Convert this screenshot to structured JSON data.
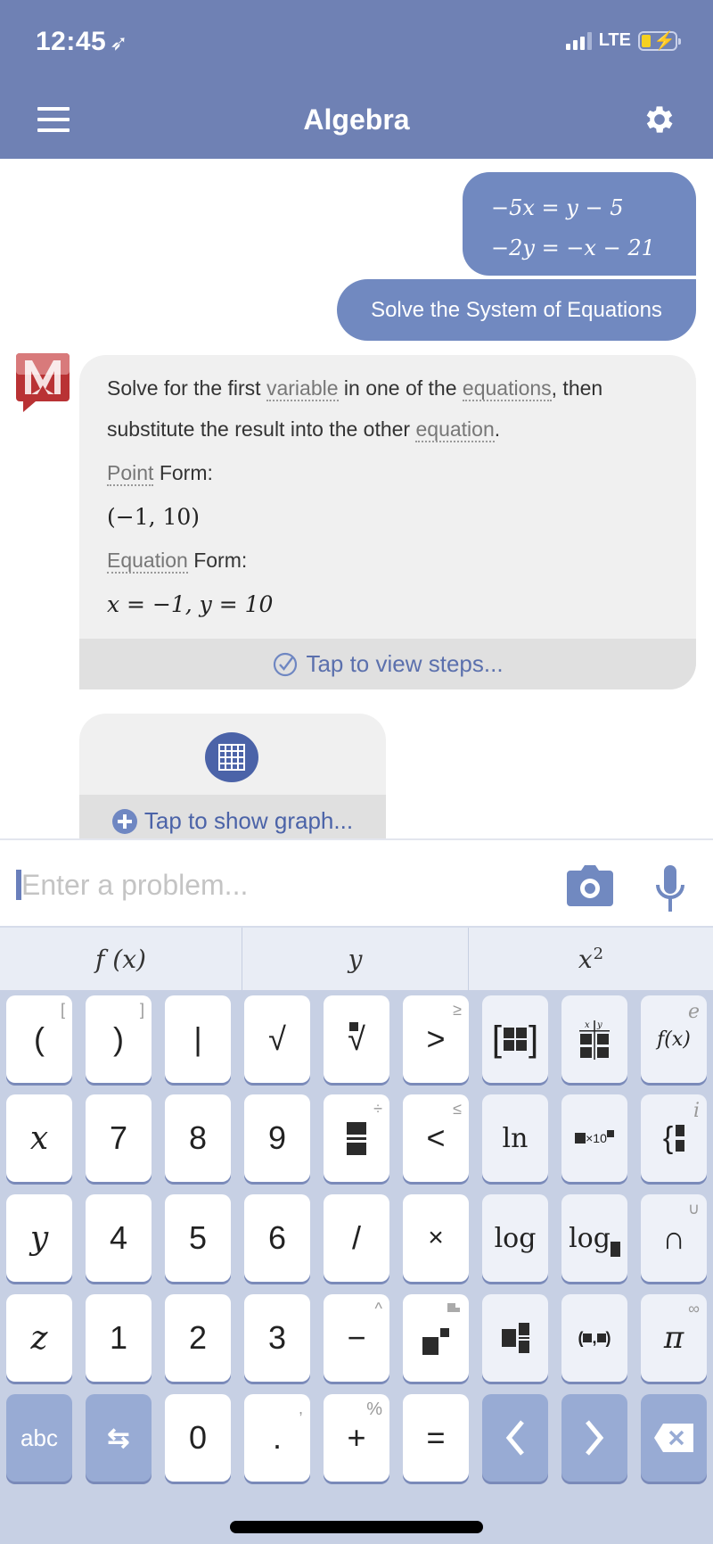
{
  "status_bar": {
    "time": "12:45",
    "network": "LTE",
    "signal_bars": 3,
    "signal_max": 4,
    "charging": true
  },
  "header": {
    "title": "Algebra",
    "menu_icon": "hamburger-menu-icon",
    "settings_icon": "gear-icon"
  },
  "colors": {
    "header_bg": "#6f81b4",
    "user_bubble": "#7189c0",
    "link_blue": "#5b70ad",
    "logo_red": "#b93234"
  },
  "chat": {
    "user_equations": [
      "−5x = y − 5",
      "−2y = −x − 21"
    ],
    "user_command": "Solve the System of Equations",
    "answer": {
      "intro_parts": [
        {
          "text": "Solve for the first ",
          "link": false
        },
        {
          "text": "variable",
          "link": true
        },
        {
          "text": " in one of the ",
          "link": false
        },
        {
          "text": "equations",
          "link": true
        },
        {
          "text": ", then substitute the result into the other ",
          "link": false
        },
        {
          "text": "equation",
          "link": true
        },
        {
          "text": ".",
          "link": false
        }
      ],
      "point_form_link": "Point",
      "point_form_label": " Form:",
      "point_form_value": "(−1, 10)",
      "equation_form_link": "Equation",
      "equation_form_label": " Form:",
      "equation_form_value": "x = −1, y = 10",
      "steps_label": "Tap to view steps..."
    },
    "graph_label": "Tap to show graph..."
  },
  "input": {
    "placeholder": "Enter a problem...",
    "value": ""
  },
  "keyboard": {
    "tabs": [
      {
        "label": "f (x)"
      },
      {
        "label": "y"
      },
      {
        "label": "x",
        "sup": "2"
      }
    ],
    "rows": [
      [
        {
          "main": "(",
          "alt": "["
        },
        {
          "main": ")",
          "alt": "]"
        },
        {
          "main": "|"
        },
        {
          "main": "√"
        },
        {
          "main": "ⁿ√",
          "name": "nth-root"
        },
        {
          "main": ">",
          "alt": "≥"
        },
        {
          "main": "matrix",
          "name": "matrix",
          "style": "light"
        },
        {
          "main": "table",
          "name": "xy-table",
          "style": "light"
        },
        {
          "main": "f(x)",
          "alt": "e",
          "style": "light"
        }
      ],
      [
        {
          "main": "x"
        },
        {
          "main": "7"
        },
        {
          "main": "8"
        },
        {
          "main": "9"
        },
        {
          "main": "fraction",
          "name": "fraction",
          "alt": "÷"
        },
        {
          "main": "<",
          "alt": "≤"
        },
        {
          "main": "ln",
          "style": "light"
        },
        {
          "main": "×10",
          "name": "scientific-notation",
          "style": "light"
        },
        {
          "main": "{",
          "name": "piecewise",
          "alt": "i",
          "style": "light"
        }
      ],
      [
        {
          "main": "y"
        },
        {
          "main": "4"
        },
        {
          "main": "5"
        },
        {
          "main": "6"
        },
        {
          "main": "/"
        },
        {
          "main": "×"
        },
        {
          "main": "log",
          "style": "light"
        },
        {
          "main": "log",
          "name": "log-base",
          "style": "light"
        },
        {
          "main": "∩",
          "alt": "∪",
          "style": "light"
        }
      ],
      [
        {
          "main": "z"
        },
        {
          "main": "1"
        },
        {
          "main": "2"
        },
        {
          "main": "3"
        },
        {
          "main": "−",
          "alt": "^"
        },
        {
          "main": "exponent",
          "name": "exponent",
          "alt": "subscript"
        },
        {
          "main": "mixed-fraction",
          "name": "mixed-fraction",
          "style": "light"
        },
        {
          "main": "(■,■)",
          "name": "ordered-pair",
          "style": "light"
        },
        {
          "main": "π",
          "alt": "∞",
          "style": "light"
        }
      ],
      [
        {
          "main": "abc",
          "style": "dark"
        },
        {
          "main": "⇆",
          "name": "swap",
          "style": "dark"
        },
        {
          "main": "0"
        },
        {
          "main": ".",
          "alt": ","
        },
        {
          "main": "+",
          "alt": "%"
        },
        {
          "main": "="
        },
        {
          "main": "‹",
          "name": "cursor-left",
          "style": "dark"
        },
        {
          "main": "›",
          "name": "cursor-right",
          "style": "dark"
        },
        {
          "main": "⌫",
          "name": "backspace",
          "style": "dark"
        }
      ]
    ]
  }
}
